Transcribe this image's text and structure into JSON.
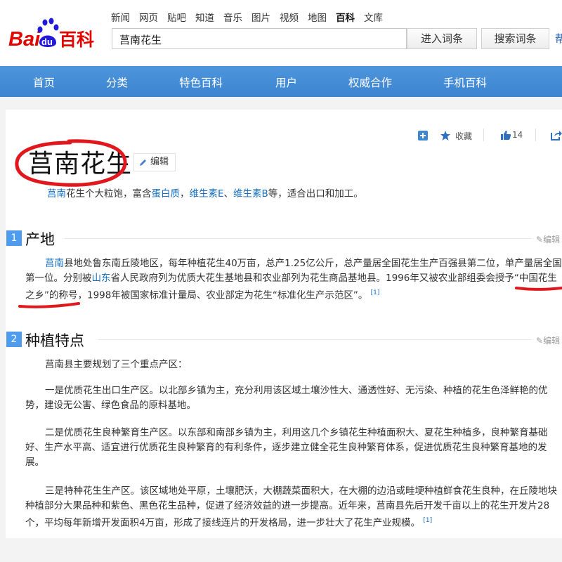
{
  "header": {
    "logo_text_left": "Bai",
    "logo_text_paw": "du",
    "logo_text_right": "百科",
    "nav_links": [
      "新闻",
      "网页",
      "贴吧",
      "知道",
      "音乐",
      "图片",
      "视频",
      "地图",
      "百科",
      "文库"
    ],
    "nav_active_index": 8,
    "search_value": "莒南花生",
    "enter_button": "进入词条",
    "search_button": "搜索词条",
    "edge_glyph": "帮"
  },
  "bluenav": {
    "items": [
      "首页",
      "分类",
      "特色百科",
      "用户",
      "权威合作",
      "手机百科"
    ]
  },
  "entry": {
    "title": "莒南花生",
    "edit_label": "编辑",
    "favorite_label": "收藏",
    "like_count": "14",
    "summary": {
      "s1_link": "莒南",
      "s1_text": "花生个大粒饱，富含",
      "s2_link": "蛋白质",
      "s2_text": "，",
      "s3_link": "维生素E",
      "s3_text": "、",
      "s4_link": "维生素B",
      "s4_text": "等，适合出口和加工。"
    }
  },
  "sections": [
    {
      "number": "1",
      "title": "产地",
      "edit": "编辑",
      "p1": {
        "a_link": "莒南",
        "a_text": "县地处鲁东南丘陵地区，每年种植花生40万亩，总产1.25亿公斤，总产量居全国花生生产百强县第二位，单产量居全国",
        "b_text": "第一位。分别被",
        "b_link": "山东",
        "b_rest": "省人民政府列为优质大花生基地县和农业部列为花生商品基地县。1996年又被农业部组委会授予“中国花生",
        "c_text": "之乡”的称号，1998年被国家标准计量局、农业部定为花生“标准化生产示范区”。",
        "ref": "[1]"
      }
    },
    {
      "number": "2",
      "title": "种植特点",
      "edit": "编辑",
      "p1": "莒南县主要规划了三个重点产区：",
      "p2_l1": "一是优质花生出口生产区。以北部乡镇为主，充分利用该区域土壤沙性大、通透性好、无污染、种植的花生色泽鲜艳的优",
      "p2_l2": "势，建设无公害、绿色食品的原料基地。",
      "p3_l1": "二是优质花生良种繁育生产区。以东部和南部乡镇为主，利用这几个乡镇花生种植面积大、夏花生种植多，良种繁育基础",
      "p3_l2": "好、生产水平高、适宜进行优质花生良种繁育的有利条件，逐步建立健全花生良种繁育体系，促进优质花生良种繁育基地的发",
      "p3_l3": "展。",
      "p4_l1": "三是特种花生生产区。该区域地处平原，土壤肥沃，大棚蔬菜面积大，在大棚的边沿或畦埂种植鲜食花生良种，在丘陵地块",
      "p4_l2": "种植部分大果品种和紫色、黑色花生品种，促进了经济效益的进一步提高。近年来，莒南县先后开发千亩以上的花生开发片28",
      "p4_l3": "个，平均每年新增开发面积4万亩，形成了接线连片的开发格局，进一步壮大了花生产业规模。",
      "ref": "[1]"
    }
  ],
  "colors": {
    "nav_blue": "#4a91da",
    "link_blue": "#136ec2",
    "section_badge": "#4f9cee",
    "annotation_red": "#e0171c",
    "logo_red": "#e10601",
    "logo_blue": "#2319dc"
  }
}
